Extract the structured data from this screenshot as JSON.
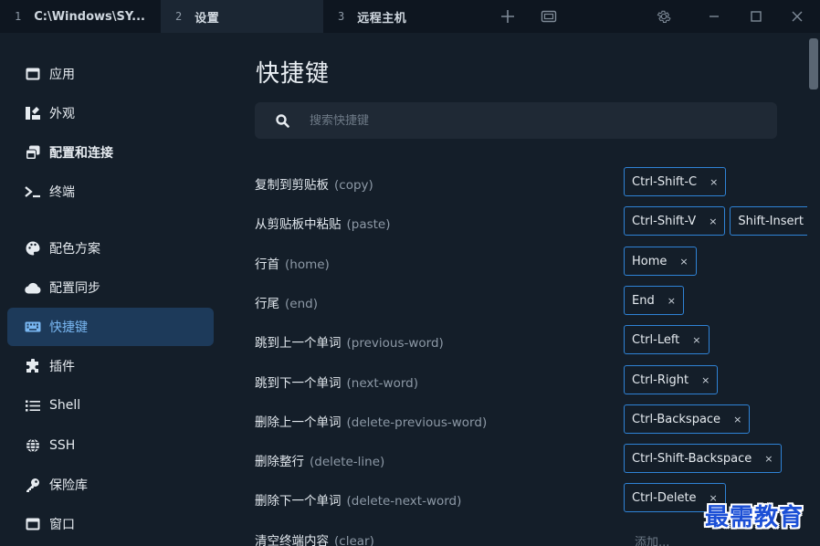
{
  "tabs": [
    {
      "num": "1",
      "title": "C:\\Windows\\SY..."
    },
    {
      "num": "2",
      "title": "设置"
    },
    {
      "num": "3",
      "title": "远程主机"
    }
  ],
  "titlebar": {
    "icons": [
      "plus-icon",
      "window-icon",
      "gear-icon",
      "minimize-icon",
      "maximize-icon",
      "close-icon"
    ]
  },
  "sidebar": {
    "items": [
      {
        "label": "应用",
        "icon": "application-icon"
      },
      {
        "label": "外观",
        "icon": "appearance-icon"
      },
      {
        "label": "配置和连接",
        "icon": "profiles-icon"
      },
      {
        "label": "终端",
        "icon": "terminal-icon"
      },
      {
        "label": "配色方案",
        "icon": "palette-icon"
      },
      {
        "label": "配置同步",
        "icon": "cloud-icon"
      },
      {
        "label": "快捷键",
        "icon": "keyboard-icon"
      },
      {
        "label": "插件",
        "icon": "puzzle-icon"
      },
      {
        "label": "Shell",
        "icon": "list-icon"
      },
      {
        "label": "SSH",
        "icon": "globe-icon"
      },
      {
        "label": "保险库",
        "icon": "key-icon"
      },
      {
        "label": "窗口",
        "icon": "window-icon"
      }
    ],
    "active": "快捷键"
  },
  "main": {
    "title": "快捷键",
    "search_placeholder": "搜索快捷键",
    "hotkeys": [
      {
        "label": "复制到剪贴板",
        "id": "(copy)",
        "keys": [
          "Ctrl-Shift-C"
        ]
      },
      {
        "label": "从剪贴板中粘贴",
        "id": "(paste)",
        "keys": [
          "Ctrl-Shift-V",
          "Shift-Insert"
        ]
      },
      {
        "label": "行首",
        "id": "(home)",
        "keys": [
          "Home"
        ]
      },
      {
        "label": "行尾",
        "id": "(end)",
        "keys": [
          "End"
        ]
      },
      {
        "label": "跳到上一个单词",
        "id": "(previous-word)",
        "keys": [
          "Ctrl-Left"
        ]
      },
      {
        "label": "跳到下一个单词",
        "id": "(next-word)",
        "keys": [
          "Ctrl-Right"
        ]
      },
      {
        "label": "删除上一个单词",
        "id": "(delete-previous-word)",
        "keys": [
          "Ctrl-Backspace"
        ]
      },
      {
        "label": "删除整行",
        "id": "(delete-line)",
        "keys": [
          "Ctrl-Shift-Backspace"
        ]
      },
      {
        "label": "删除下一个单词",
        "id": "(delete-next-word)",
        "keys": [
          "Ctrl-Delete"
        ]
      },
      {
        "label": "清空终端内容",
        "id": "(clear)",
        "keys": []
      }
    ],
    "remove_glyph": "×",
    "add_label": "添加..."
  },
  "watermark": "最需教育",
  "colors": {
    "background": "#141e29",
    "tabbar": "#0e1620",
    "active_sidebar": "#1d3a5a",
    "accent": "#79b7f2",
    "chip_border": "#2f83d6"
  }
}
